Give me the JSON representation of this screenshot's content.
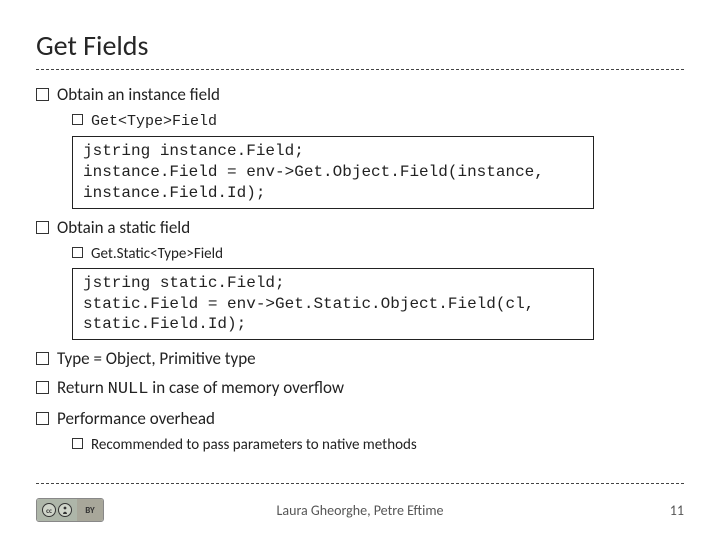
{
  "title": "Get Fields",
  "bullets": {
    "b1": "Obtain an instance field",
    "b1a": "Get<Type>Field",
    "code1": "jstring instance.Field;\ninstance.Field = env->Get.Object.Field(instance,\ninstance.Field.Id);",
    "b2": "Obtain a static field",
    "b2a": "Get.Static<Type>Field",
    "code2": "jstring static.Field;\nstatic.Field = env->Get.Static.Object.Field(cl,\nstatic.Field.Id);",
    "b3_pre": "Type = Object, Primitive type",
    "b4_pre": "Return ",
    "b4_mono": "NULL",
    "b4_post": " in case of memory overflow",
    "b5": "Performance overhead",
    "b5a": "Recommended to pass parameters to native methods"
  },
  "footer": {
    "authors": "Laura Gheorghe, Petre Eftime",
    "page": "11",
    "cc_by": "BY",
    "cc_cc": "cc"
  }
}
